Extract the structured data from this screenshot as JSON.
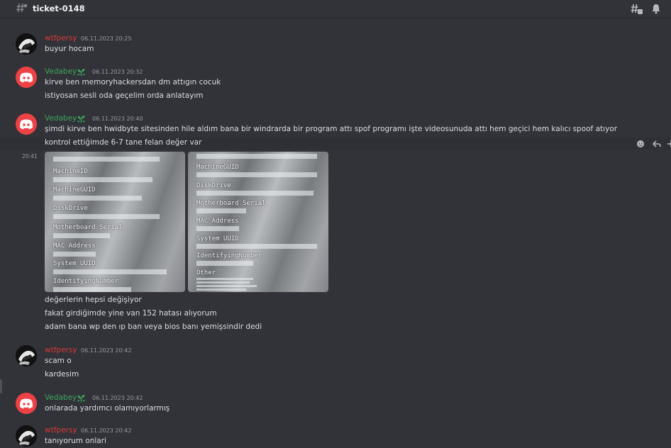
{
  "channel": {
    "name": "ticket-0148"
  },
  "icons": {
    "channel": "text-channel-thread-icon",
    "threads": "threads-icon",
    "notifications": "bell-icon",
    "verified": "plant-icon",
    "react": "add-reaction-icon",
    "reply": "reply-icon"
  },
  "colors": {
    "wtfpersy": "#d93a3a",
    "vedabey": "#3ba55d",
    "background": "#313338"
  },
  "messages": {
    "m1": {
      "user": "wtfpersy",
      "time": "06.11.2023 20:25",
      "lines": [
        "buyur hocam"
      ]
    },
    "m2": {
      "user": "Vedabey",
      "time": "06.11.2023 20:32",
      "lines": [
        "kirve ben memoryhackersdan dm attıgın cocuk",
        "istiyosan sesli oda geçelim orda anlatayım"
      ]
    },
    "m3": {
      "user": "Vedabey",
      "time": "06.11.2023 20:40",
      "lines": [
        "şimdi  kirve ben hwidbyte sitesinden hile aldım bana bir windrarda bir program attı spof programı işte videosunuda attı  hem geçici hem kalıcı spoof atıyor",
        "kontrol ettiğimde   6-7 tane felan  değer var"
      ],
      "side_time": "20:41",
      "image1_labels": [
        "MachineID",
        "MachineGUID",
        "DiskDrive",
        "Motherboard Serial",
        "MAC Address",
        "System UUID",
        "IdentifyingNumber"
      ],
      "image2_labels": [
        "MachineGUID",
        "DiskDrive",
        "Motherboard Serial",
        "MAC Address",
        "System UUID",
        "IdentifyingNumber",
        "Other"
      ],
      "lines_after": [
        "değerlerin hepsi değişiyor",
        "fakat girdiğimde yine van 152 hatası alıyorum",
        "adam bana wp den ıp ban veya bios banı yemişsindir dedi"
      ]
    },
    "m4": {
      "user": "wtfpersy",
      "time": "06.11.2023 20:42",
      "lines": [
        "scam o",
        "kardesim"
      ]
    },
    "m5": {
      "user": "Vedabey",
      "time": "06.11.2023 20:42",
      "lines": [
        "onlarada yardımcı olamıyorlarmış"
      ]
    },
    "m6": {
      "user": "wtfpersy",
      "time": "06.11.2023 20:42",
      "lines": [
        "tanıyorum onlari"
      ]
    }
  }
}
